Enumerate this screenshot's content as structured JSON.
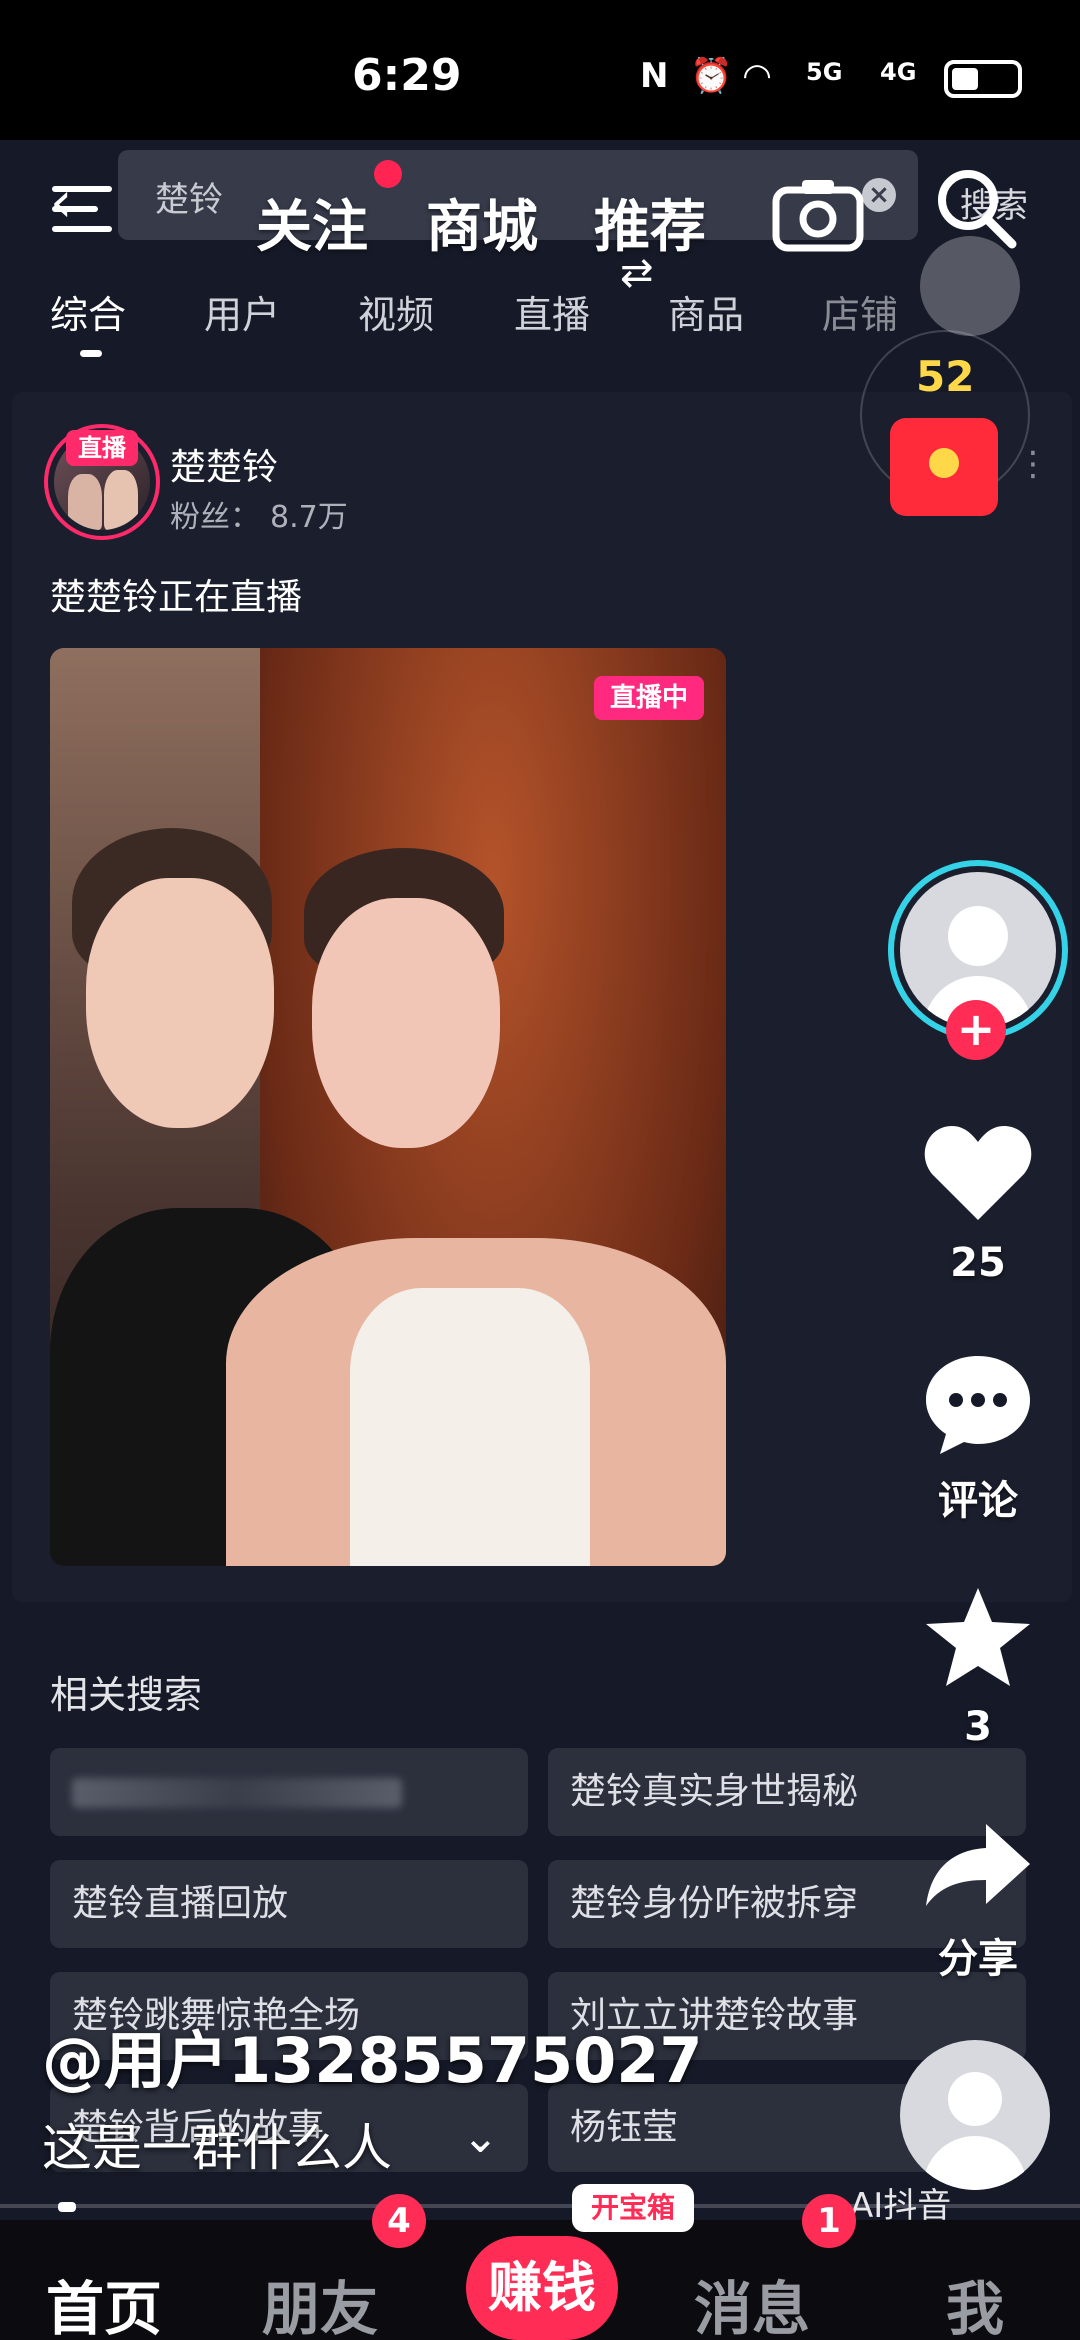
{
  "status_bar": {
    "time": "6:29",
    "network_1": "5G",
    "network_2": "4G"
  },
  "search": {
    "query": "楚铃",
    "search_button": "搜索"
  },
  "feed_tabs": [
    {
      "label": "关注"
    },
    {
      "label": "商城"
    },
    {
      "label": "推荐"
    }
  ],
  "categories": [
    {
      "label": "综合"
    },
    {
      "label": "用户"
    },
    {
      "label": "视频"
    },
    {
      "label": "直播"
    },
    {
      "label": "商品"
    },
    {
      "label": "店铺"
    }
  ],
  "result": {
    "avatar_badge": "直播",
    "username": "楚楚铃",
    "fans_label": "粉丝：",
    "fans_value": "8.7万",
    "live_description": "楚楚铃正在直播",
    "video_tag": "直播中"
  },
  "related": {
    "title": "相关搜索",
    "items": [
      {
        "label": ""
      },
      {
        "label": "楚铃真实身世揭秘"
      },
      {
        "label": "楚铃直播回放"
      },
      {
        "label": "楚铃身份咋被拆穿"
      },
      {
        "label": "楚铃跳舞惊艳全场"
      },
      {
        "label": "刘立立讲楚铃故事"
      },
      {
        "label": "楚铃背后的故事"
      },
      {
        "label": "杨钰莹"
      }
    ]
  },
  "side": {
    "timer_count": "52",
    "likes": "25",
    "comment_label": "评论",
    "favorites": "3",
    "share_label": "分享"
  },
  "video_overlay": {
    "author": "@用户13285575027",
    "caption": "这是一群什么人",
    "watermark": "AI抖音"
  },
  "nav": {
    "home": "首页",
    "friends": "朋友",
    "friends_badge": "4",
    "earn": "赚钱",
    "treasure": "开宝箱",
    "messages": "消息",
    "messages_badge": "1",
    "me": "我"
  },
  "colors": {
    "accent": "#ff2c55",
    "live_pink": "#ff2a7f",
    "timer_yellow": "#ffd84a",
    "ring_cyan": "#35d3e8"
  }
}
